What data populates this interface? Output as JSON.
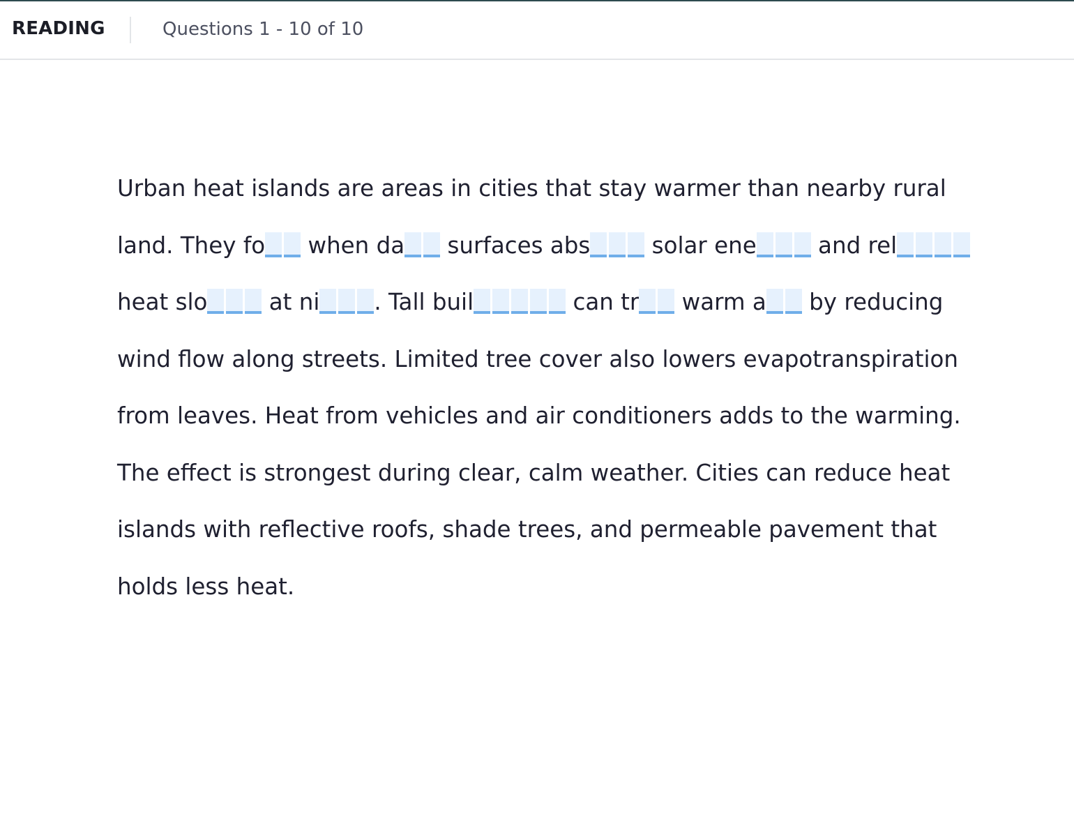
{
  "header": {
    "section_title": "READING",
    "question_range": "Questions 1 - 10 of 10"
  },
  "passage": {
    "segments": [
      {
        "type": "text",
        "value": "Urban heat islands are areas in cities that stay warmer than nearby rural land. They fo"
      },
      {
        "type": "blank",
        "id": 1,
        "letters": 2,
        "value": ""
      },
      {
        "type": "text",
        "value": " when da"
      },
      {
        "type": "blank",
        "id": 2,
        "letters": 2,
        "value": ""
      },
      {
        "type": "text",
        "value": " surfaces abs"
      },
      {
        "type": "blank",
        "id": 3,
        "letters": 3,
        "value": ""
      },
      {
        "type": "text",
        "value": " solar ene"
      },
      {
        "type": "blank",
        "id": 4,
        "letters": 3,
        "value": ""
      },
      {
        "type": "text",
        "value": " and rel"
      },
      {
        "type": "blank",
        "id": 5,
        "letters": 4,
        "value": ""
      },
      {
        "type": "text",
        "value": " heat slo"
      },
      {
        "type": "blank",
        "id": 6,
        "letters": 3,
        "value": ""
      },
      {
        "type": "text",
        "value": " at ni"
      },
      {
        "type": "blank",
        "id": 7,
        "letters": 3,
        "value": ""
      },
      {
        "type": "text",
        "value": ". Tall buil"
      },
      {
        "type": "blank",
        "id": 8,
        "letters": 5,
        "value": ""
      },
      {
        "type": "text",
        "value": " can tr"
      },
      {
        "type": "blank",
        "id": 9,
        "letters": 2,
        "value": ""
      },
      {
        "type": "text",
        "value": " warm a"
      },
      {
        "type": "blank",
        "id": 10,
        "letters": 2,
        "value": ""
      },
      {
        "type": "text",
        "value": " by reducing wind flow along streets. Limited tree cover also lowers evapotranspiration from leaves. Heat from vehicles and air conditioners adds to the warming. The effect is strongest during clear, calm weather. Cities can reduce heat islands with reflective roofs, shade trees, and permeable pavement that holds less heat."
      }
    ]
  },
  "colors": {
    "blank_fill": "#e6f1fd",
    "blank_underline": "#70aee9",
    "top_accent": "#2d4a4f"
  }
}
